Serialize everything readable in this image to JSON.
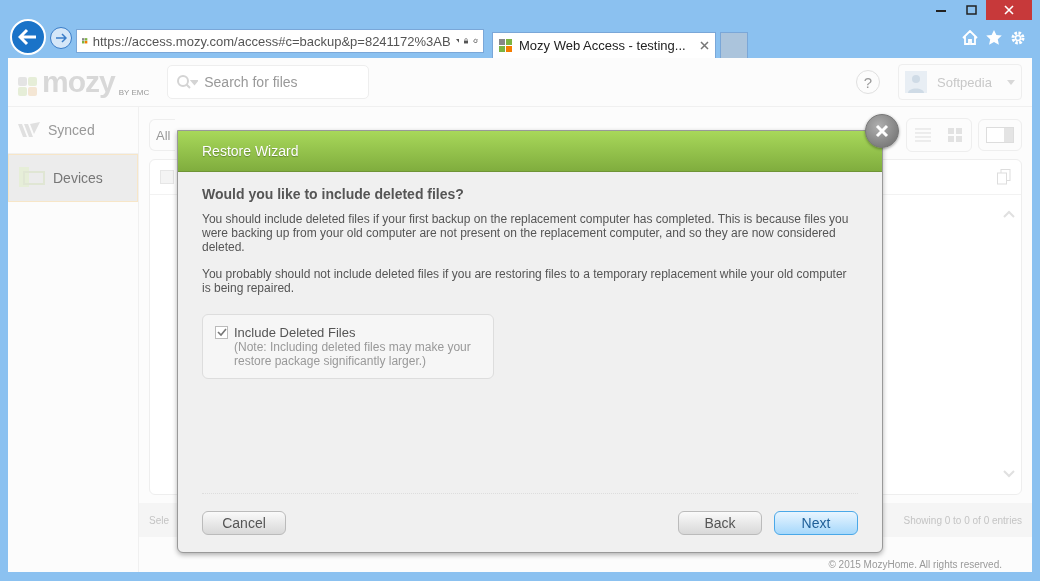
{
  "browser": {
    "address": "https://access.mozy.com/access#c=backup&p=8241172%3AB",
    "tab": {
      "title": "Mozy Web Access - testing..."
    }
  },
  "app": {
    "logo": "mozy",
    "logo_tagline": "BY EMC",
    "search": {
      "placeholder": "Search for files"
    },
    "help": "?",
    "user": "Softpedia",
    "sidebar": [
      {
        "label": "Synced",
        "selected": false
      },
      {
        "label": "Devices",
        "selected": true
      }
    ],
    "filter_tab": "All",
    "footer_left": "Sele",
    "entries": "Showing 0 to 0 of 0 entries",
    "copyright": "© 2015 MozyHome. All rights reserved."
  },
  "dialog": {
    "title": "Restore Wizard",
    "heading": "Would you like to include deleted files?",
    "paragraphs": [
      "You should include deleted files if your first backup on the replacement computer has completed. This is because files you were backing up from your old computer are not present on the replacement computer, and so they are now considered deleted.",
      "You probably should not include deleted files if you are restoring files to a temporary replacement while your old computer is being repaired."
    ],
    "option": {
      "label": "Include Deleted Files",
      "note": "(Note: Including deleted files may make your restore package significantly larger.)",
      "checked": true
    },
    "buttons": [
      {
        "label": "Cancel",
        "kind": "cancel"
      },
      {
        "label": "Back",
        "kind": "secondary"
      },
      {
        "label": "Next",
        "kind": "primary"
      }
    ]
  }
}
